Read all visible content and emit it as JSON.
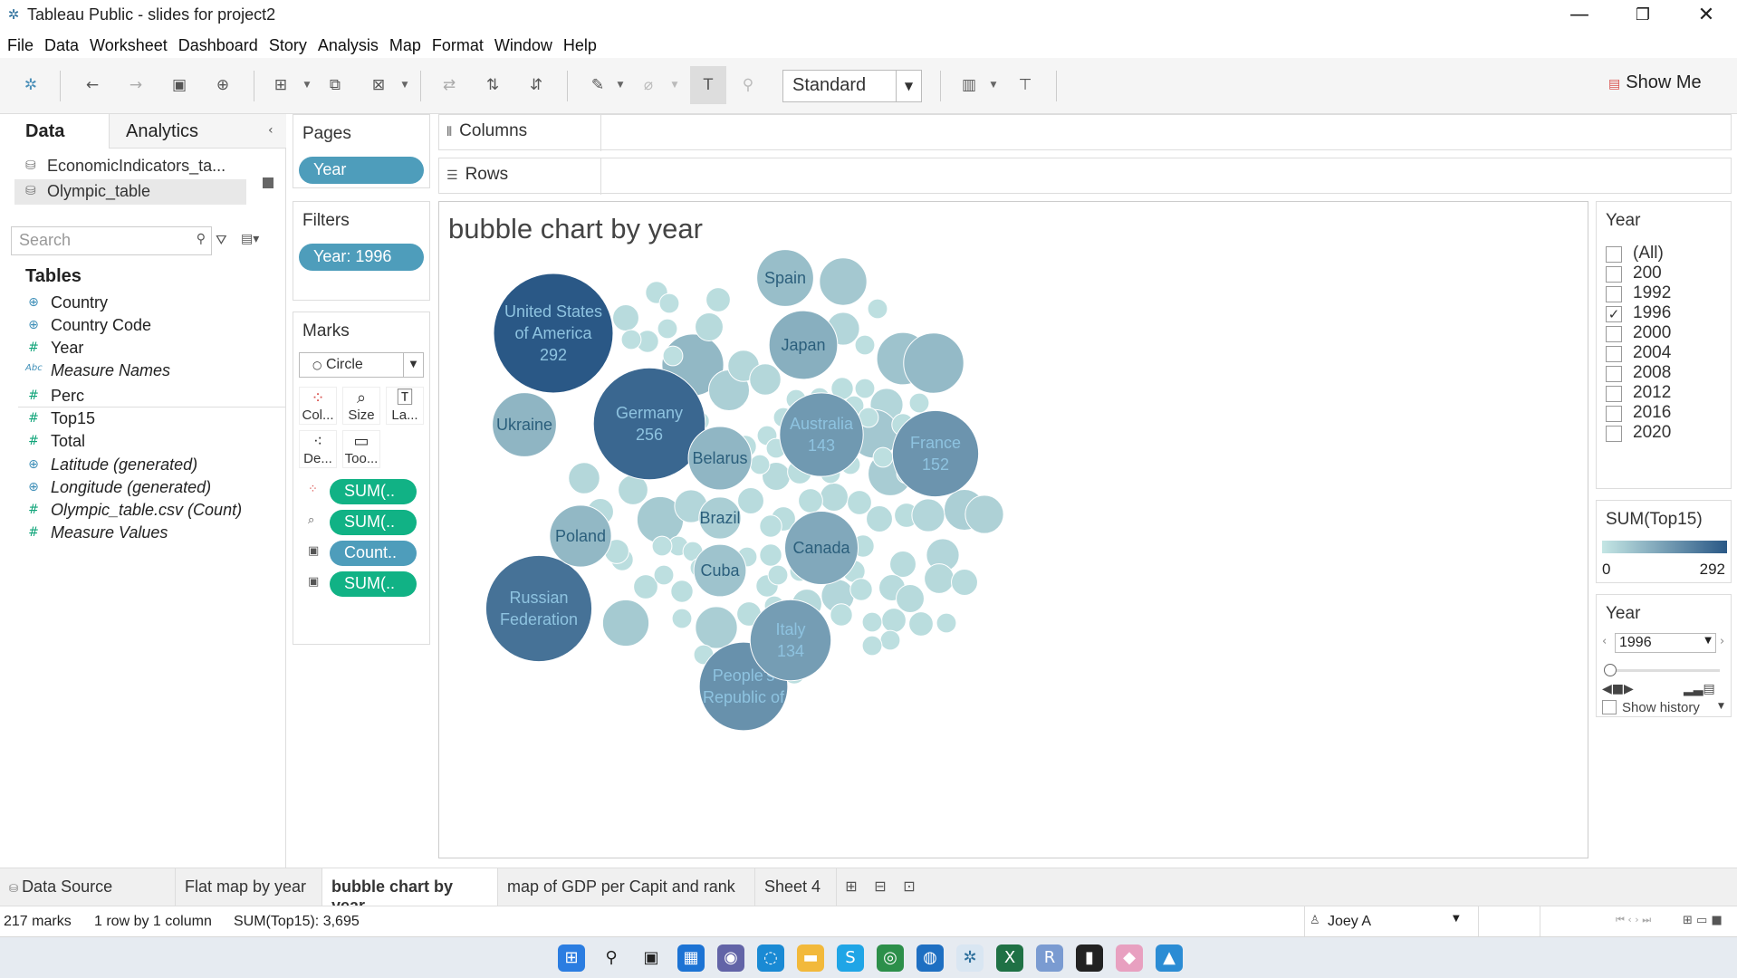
{
  "window": {
    "title": "Tableau Public - slides for project2",
    "minimize": "—",
    "restore": "❐",
    "close": "✕"
  },
  "menu": [
    "File",
    "Data",
    "Worksheet",
    "Dashboard",
    "Story",
    "Analysis",
    "Map",
    "Format",
    "Window",
    "Help"
  ],
  "toolbar": {
    "fit": "Standard",
    "show_me": "Show Me"
  },
  "left": {
    "tabs": {
      "data": "Data",
      "analytics": "Analytics"
    },
    "sources": [
      "EconomicIndicators_ta...",
      "Olympic_table"
    ],
    "search_placeholder": "Search",
    "tables_heading": "Tables",
    "fields": [
      {
        "name": "Country",
        "icon": "globe-icon",
        "italic": false
      },
      {
        "name": "Country Code",
        "icon": "globe-icon",
        "italic": false
      },
      {
        "name": "Year",
        "icon": "number-icon",
        "italic": false
      },
      {
        "name": "Measure Names",
        "icon": "abc-icon",
        "italic": true
      },
      {
        "name": "Perc",
        "icon": "number-icon",
        "italic": false
      },
      {
        "name": "Top15",
        "icon": "number-icon",
        "italic": false
      },
      {
        "name": "Total",
        "icon": "number-icon",
        "italic": false
      },
      {
        "name": "Latitude (generated)",
        "icon": "globe-icon",
        "italic": true
      },
      {
        "name": "Longitude (generated)",
        "icon": "globe-icon",
        "italic": true
      },
      {
        "name": "Olympic_table.csv (Count)",
        "icon": "number-icon",
        "italic": true
      },
      {
        "name": "Measure Values",
        "icon": "number-icon",
        "italic": true
      }
    ]
  },
  "cards": {
    "pages_title": "Pages",
    "pages_pill": "Year",
    "filters_title": "Filters",
    "filters_pill": "Year: 1996",
    "marks_title": "Marks",
    "mark_type": "Circle",
    "mark_buttons": [
      "Col...",
      "Size",
      "La...",
      "De...",
      "Too..."
    ],
    "mark_pills": [
      "SUM(..",
      "SUM(..",
      "Count..",
      "SUM(.."
    ]
  },
  "shelves": {
    "columns": "Columns",
    "rows": "Rows"
  },
  "viz": {
    "title": "bubble chart by year"
  },
  "legend_year": {
    "title": "Year",
    "items": [
      {
        "label": "(All)",
        "checked": false
      },
      {
        "label": "200",
        "checked": false
      },
      {
        "label": "1992",
        "checked": false
      },
      {
        "label": "1996",
        "checked": true
      },
      {
        "label": "2000",
        "checked": false
      },
      {
        "label": "2004",
        "checked": false
      },
      {
        "label": "2008",
        "checked": false
      },
      {
        "label": "2012",
        "checked": false
      },
      {
        "label": "2016",
        "checked": false
      },
      {
        "label": "2020",
        "checked": false
      }
    ],
    "check_glyph": "✓"
  },
  "legend_color": {
    "title": "SUM(Top15)",
    "min": "0",
    "max": "292",
    "color_low": "#c4e6e4",
    "color_high": "#2a5886"
  },
  "page_control": {
    "title": "Year",
    "value": "1996",
    "show_history": "Show history"
  },
  "sheet_tabs": {
    "data_source": "Data Source",
    "tabs": [
      "Flat map by year",
      "bubble chart by year",
      "map of GDP per Capit and rank",
      "Sheet 4"
    ],
    "active": 1
  },
  "status": {
    "marks": "217 marks",
    "dims": "1 row by 1 column",
    "sum": "SUM(Top15): 3,695",
    "user": "Joey A"
  },
  "chart_data": {
    "type": "bubble",
    "title": "bubble chart by year",
    "measure": "SUM(Top15)",
    "filter": "Year: 1996",
    "color_range": [
      0,
      292
    ],
    "labeled_bubbles": [
      {
        "name": "United States of America",
        "label_lines": [
          "United States",
          "of America",
          "292"
        ],
        "value": 292
      },
      {
        "name": "Germany",
        "label_lines": [
          "Germany",
          "256"
        ],
        "value": 256
      },
      {
        "name": "Russian Federation",
        "label_lines": [
          "Russian",
          "Federation"
        ],
        "value": 230
      },
      {
        "name": "People's Republic of China",
        "label_lines": [
          "People's",
          "Republic of"
        ],
        "value": 160
      },
      {
        "name": "France",
        "label_lines": [
          "France",
          "152"
        ],
        "value": 152
      },
      {
        "name": "Australia",
        "label_lines": [
          "Australia",
          "143"
        ],
        "value": 143
      },
      {
        "name": "Italy",
        "label_lines": [
          "Italy",
          "134"
        ],
        "value": 134
      },
      {
        "name": "Canada",
        "label_lines": [
          "Canada"
        ],
        "value": 110
      },
      {
        "name": "Japan",
        "label_lines": [
          "Japan"
        ],
        "value": 96
      },
      {
        "name": "Belarus",
        "label_lines": [
          "Belarus"
        ],
        "value": 82
      },
      {
        "name": "Ukraine",
        "label_lines": [
          "Ukraine"
        ],
        "value": 84
      },
      {
        "name": "Poland",
        "label_lines": [
          "Poland"
        ],
        "value": 78
      },
      {
        "name": "Spain",
        "label_lines": [
          "Spain"
        ],
        "value": 66
      },
      {
        "name": "Cuba",
        "label_lines": [
          "Cuba"
        ],
        "value": 56
      },
      {
        "name": "Brazil",
        "label_lines": [
          "Brazil"
        ],
        "value": 36
      }
    ]
  }
}
